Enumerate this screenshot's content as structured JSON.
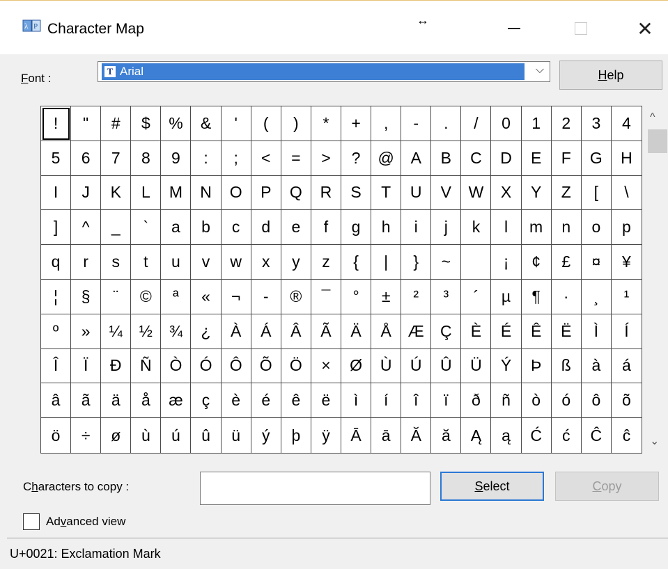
{
  "window": {
    "title": "Character Map",
    "icon": "character-map-app-icon",
    "resize_icon": "↔",
    "min_label": "",
    "max_label": "",
    "close_label": "✕"
  },
  "font": {
    "label_pre": "",
    "label_accel": "F",
    "label_post": "ont :",
    "selected": "Arial",
    "arrow": "⌵"
  },
  "help_button": {
    "accel": "H",
    "rest": "elp"
  },
  "grid": {
    "cells": [
      "!",
      "\"",
      "#",
      "$",
      "%",
      "&",
      "'",
      "(",
      ")",
      "*",
      "+",
      ",",
      "-",
      ".",
      "/",
      "0",
      "1",
      "2",
      "3",
      "4",
      "5",
      "6",
      "7",
      "8",
      "9",
      ":",
      ";",
      "<",
      "=",
      ">",
      "?",
      "@",
      "A",
      "B",
      "C",
      "D",
      "E",
      "F",
      "G",
      "H",
      "I",
      "J",
      "K",
      "L",
      "M",
      "N",
      "O",
      "P",
      "Q",
      "R",
      "S",
      "T",
      "U",
      "V",
      "W",
      "X",
      "Y",
      "Z",
      "[",
      "\\",
      "]",
      "^",
      "_",
      "`",
      "a",
      "b",
      "c",
      "d",
      "e",
      "f",
      "g",
      "h",
      "i",
      "j",
      "k",
      "l",
      "m",
      "n",
      "o",
      "p",
      "q",
      "r",
      "s",
      "t",
      "u",
      "v",
      "w",
      "x",
      "y",
      "z",
      "{",
      "|",
      "}",
      "~",
      " ",
      "¡",
      "¢",
      "£",
      "¤",
      "¥",
      "¦",
      "§",
      "¨",
      "©",
      "ª",
      "«",
      "¬",
      "-",
      "®",
      "¯",
      "°",
      "±",
      "²",
      "³",
      "´",
      "µ",
      "¶",
      "·",
      "¸",
      "¹",
      "º",
      "»",
      "¼",
      "½",
      "¾",
      "¿",
      "À",
      "Á",
      "Â",
      "Ã",
      "Ä",
      "Å",
      "Æ",
      "Ç",
      "È",
      "É",
      "Ê",
      "Ë",
      "Ì",
      "Í",
      "Î",
      "Ï",
      "Ð",
      "Ñ",
      "Ò",
      "Ó",
      "Ô",
      "Õ",
      "Ö",
      "×",
      "Ø",
      "Ù",
      "Ú",
      "Û",
      "Ü",
      "Ý",
      "Þ",
      "ß",
      "à",
      "á",
      "â",
      "ã",
      "ä",
      "å",
      "æ",
      "ç",
      "è",
      "é",
      "ê",
      "ë",
      "ì",
      "í",
      "î",
      "ï",
      "ð",
      "ñ",
      "ò",
      "ó",
      "ô",
      "õ",
      "ö",
      "÷",
      "ø",
      "ù",
      "ú",
      "û",
      "ü",
      "ý",
      "þ",
      "ÿ",
      "Ā",
      "ā",
      "Ă",
      "ă",
      "Ą",
      "ą",
      "Ć",
      "ć",
      "Ĉ",
      "ĉ"
    ],
    "selected_index": 0
  },
  "scroll": {
    "up": "^",
    "down": "⌄"
  },
  "copy": {
    "label_pre": "C",
    "label_accel": "h",
    "label_post": "aracters to copy :",
    "value": ""
  },
  "select_button": {
    "accel": "S",
    "rest": "elect"
  },
  "copy_button": {
    "accel": "C",
    "rest": "opy"
  },
  "advanced": {
    "pre": "Ad",
    "accel": "v",
    "post": "anced view",
    "checked": false
  },
  "status": "U+0021: Exclamation Mark"
}
